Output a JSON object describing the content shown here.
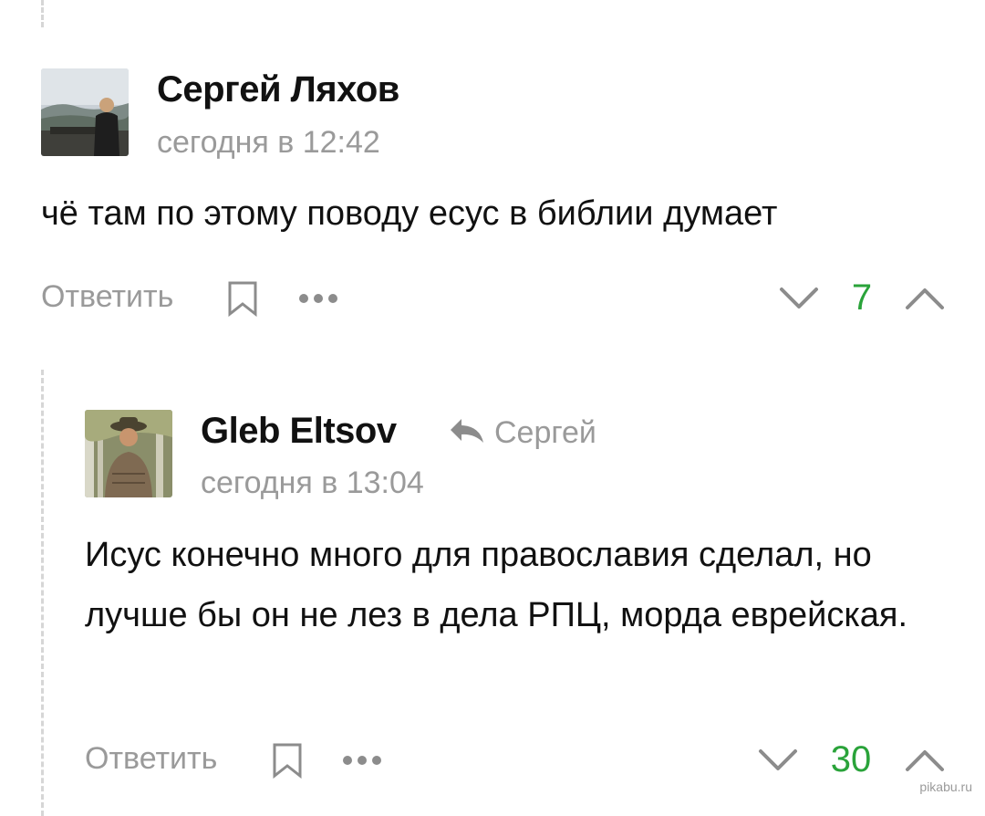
{
  "comments": [
    {
      "author": "Сергей Ляхов",
      "timestamp": "сегодня в 12:42",
      "text": "чё там по этому поводу есус в библии думает",
      "actions": {
        "reply_label": "Ответить",
        "bookmark_icon": "bookmark-icon",
        "more_icon": "more-dots-icon",
        "downvote_icon": "chevron-down-icon",
        "upvote_icon": "chevron-up-icon"
      },
      "rating": "7"
    },
    {
      "author": "Gleb Eltsov",
      "reply_to": "Сергей",
      "timestamp": "сегодня в 13:04",
      "text": "Исус конечно много для православия сделал, но лучше бы он не лез в дела РПЦ, морда еврейская.",
      "actions": {
        "reply_label": "Ответить",
        "bookmark_icon": "bookmark-icon",
        "more_icon": "more-dots-icon",
        "downvote_icon": "chevron-down-icon",
        "upvote_icon": "chevron-up-icon"
      },
      "rating": "30"
    }
  ],
  "watermark": "pikabu.ru",
  "colors": {
    "rating_positive": "#2aa33a",
    "secondary_text": "#9a9a9a",
    "icon_gray": "#8c8c8c",
    "thread_line": "#d6d6d6"
  }
}
